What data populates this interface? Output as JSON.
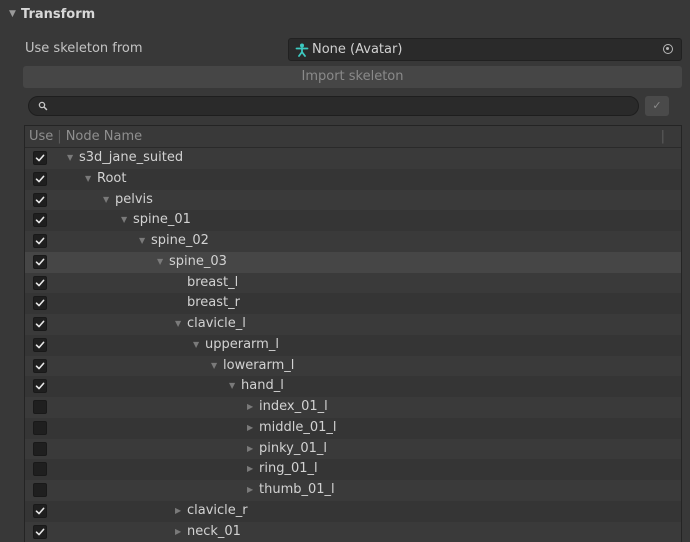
{
  "section": {
    "title": "Transform"
  },
  "skeleton_field": {
    "label": "Use skeleton from",
    "value": "None (Avatar)"
  },
  "import_button": {
    "label": "Import skeleton"
  },
  "search": {
    "value": "",
    "apply_label": "✓"
  },
  "tree": {
    "headers": {
      "use": "Use",
      "separator": "|",
      "node_name": "Node Name",
      "end_separator": "|"
    },
    "rows": [
      {
        "name": "s3d_jane_suited",
        "checked": true,
        "depth": 0,
        "arrow": "expanded"
      },
      {
        "name": "Root",
        "checked": true,
        "depth": 1,
        "arrow": "expanded"
      },
      {
        "name": "pelvis",
        "checked": true,
        "depth": 2,
        "arrow": "expanded"
      },
      {
        "name": "spine_01",
        "checked": true,
        "depth": 3,
        "arrow": "expanded"
      },
      {
        "name": "spine_02",
        "checked": true,
        "depth": 4,
        "arrow": "expanded"
      },
      {
        "name": "spine_03",
        "checked": true,
        "depth": 5,
        "arrow": "expanded",
        "selected": true
      },
      {
        "name": "breast_l",
        "checked": true,
        "depth": 6,
        "arrow": "none"
      },
      {
        "name": "breast_r",
        "checked": true,
        "depth": 6,
        "arrow": "none"
      },
      {
        "name": "clavicle_l",
        "checked": true,
        "depth": 6,
        "arrow": "expanded"
      },
      {
        "name": "upperarm_l",
        "checked": true,
        "depth": 7,
        "arrow": "expanded"
      },
      {
        "name": "lowerarm_l",
        "checked": true,
        "depth": 8,
        "arrow": "expanded"
      },
      {
        "name": "hand_l",
        "checked": true,
        "depth": 9,
        "arrow": "expanded"
      },
      {
        "name": "index_01_l",
        "checked": false,
        "depth": 10,
        "arrow": "collapsed"
      },
      {
        "name": "middle_01_l",
        "checked": false,
        "depth": 10,
        "arrow": "collapsed"
      },
      {
        "name": "pinky_01_l",
        "checked": false,
        "depth": 10,
        "arrow": "collapsed"
      },
      {
        "name": "ring_01_l",
        "checked": false,
        "depth": 10,
        "arrow": "collapsed"
      },
      {
        "name": "thumb_01_l",
        "checked": false,
        "depth": 10,
        "arrow": "collapsed"
      },
      {
        "name": "clavicle_r",
        "checked": true,
        "depth": 6,
        "arrow": "collapsed"
      },
      {
        "name": "neck_01",
        "checked": true,
        "depth": 6,
        "arrow": "collapsed"
      }
    ]
  },
  "colors": {
    "background": "#383838",
    "avatar_icon": "#3cc9c0",
    "checkmark": "#e8e8e8"
  }
}
